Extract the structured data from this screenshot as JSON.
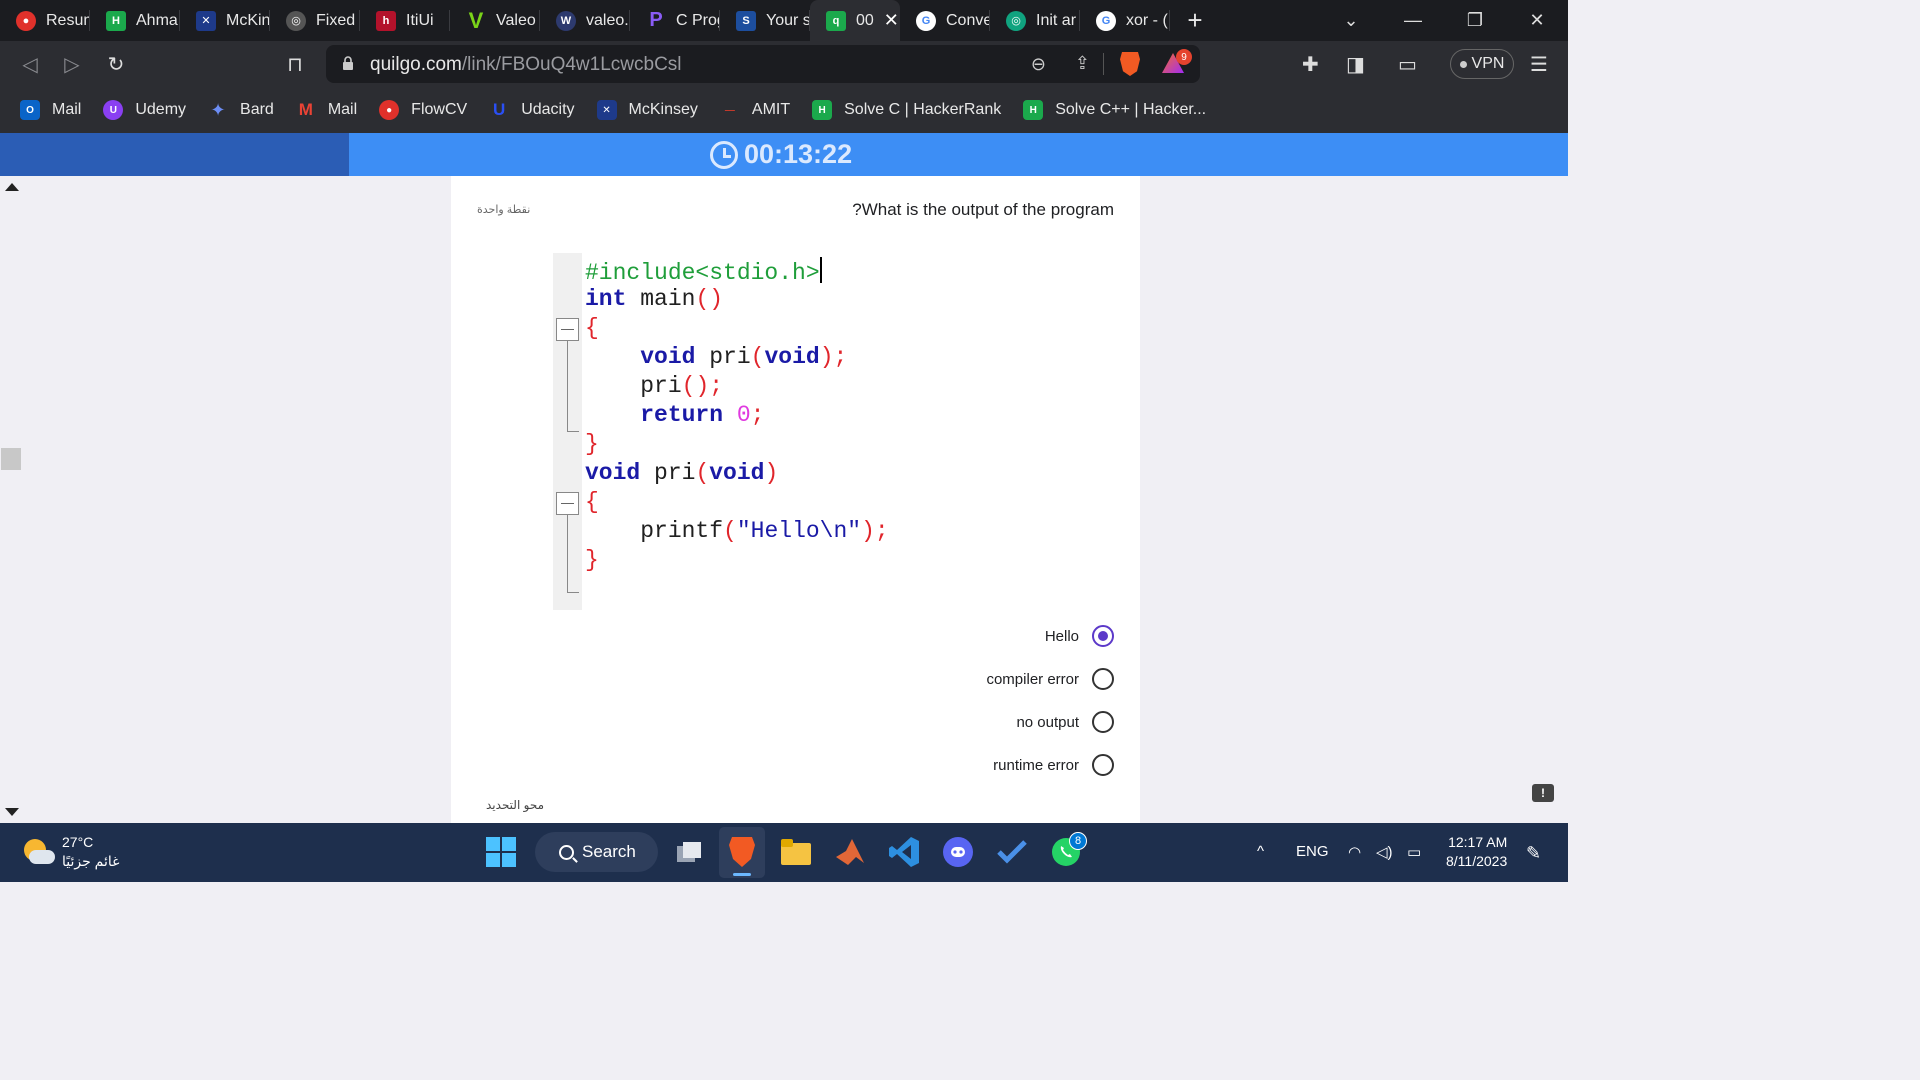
{
  "browser": {
    "tabs": [
      {
        "label": "Resum",
        "color": "#e0312b",
        "glyph": "●"
      },
      {
        "label": "Ahma",
        "color": "#1ba94c",
        "glyph": "H"
      },
      {
        "label": "McKin",
        "color": "#1e3a8a",
        "glyph": "✕"
      },
      {
        "label": "Fixed",
        "color": "#555555",
        "glyph": "◎"
      },
      {
        "label": "ItiUi",
        "color": "#b3122b",
        "glyph": "h"
      },
      {
        "label": "Valeo",
        "color": "#7ad319",
        "glyph": "V"
      },
      {
        "label": "valeo.",
        "color": "#2d3a6e",
        "glyph": "W"
      },
      {
        "label": "C Prog",
        "color": "#5b2ac7",
        "glyph": "P"
      },
      {
        "label": "Your s",
        "color": "#1d4e9e",
        "glyph": "S"
      },
      {
        "label": "00",
        "color": "#1ba94c",
        "glyph": "q",
        "active": true
      },
      {
        "label": "Conve",
        "color": "#ffffff",
        "glyph": "G"
      },
      {
        "label": "Init ar",
        "color": "#10a37f",
        "glyph": "◎"
      },
      {
        "label": "xor - (",
        "color": "#ffffff",
        "glyph": "G"
      }
    ],
    "new_tab_symbol": "+",
    "url_host": "quilgo.com",
    "url_path": "/link/FBOuQ4w1LcwcbCsl",
    "rewards_badge": "9",
    "vpn_label": "VPN",
    "bookmarks": [
      {
        "label": "Mail",
        "color": "#0a64c8",
        "glyph": "O"
      },
      {
        "label": "Udemy",
        "color": "#8a3ff2",
        "glyph": "U"
      },
      {
        "label": "Bard",
        "color": "#4b7bec",
        "glyph": "✦"
      },
      {
        "label": "Mail",
        "color": "#ea4335",
        "glyph": "M"
      },
      {
        "label": "FlowCV",
        "color": "#e0312b",
        "glyph": "●"
      },
      {
        "label": "Udacity",
        "color": "#2a4ff5",
        "glyph": "U"
      },
      {
        "label": "McKinsey",
        "color": "#1e3a8a",
        "glyph": "✕"
      },
      {
        "label": "AMIT",
        "color": "#c0392b",
        "glyph": "—"
      },
      {
        "label": "Solve C | HackerRank",
        "color": "#1ba94c",
        "glyph": "H"
      },
      {
        "label": "Solve C++ | Hacker...",
        "color": "#1ba94c",
        "glyph": "H"
      }
    ]
  },
  "quiz": {
    "timer": "00:13:22",
    "points_label": "نقطة واحدة",
    "question": "?What is the output of the program",
    "code": {
      "l1": "#include<stdio.h>",
      "l2_kw": "int",
      "l2_name": " main",
      "l2_paren": "()",
      "l3": "{",
      "l4_kw1": "void",
      "l4_name": " pri",
      "l4_p1": "(",
      "l4_kw2": "void",
      "l4_p2": ")",
      "l4_semi": ";",
      "l5_name": "pri",
      "l5_paren": "()",
      "l5_semi": ";",
      "l6_kw": "return",
      "l6_num": "0",
      "l6_semi": ";",
      "l7": "}",
      "l8_kw1": "void",
      "l8_name": " pri",
      "l8_p1": "(",
      "l8_kw2": "void",
      "l8_p2": ")",
      "l9": "{",
      "l10_name": "printf",
      "l10_p1": "(",
      "l10_str": "\"Hello\\n\"",
      "l10_p2": ")",
      "l10_semi": ";",
      "l11": "}"
    },
    "options": [
      {
        "label": "Hello",
        "selected": true
      },
      {
        "label": "compiler error",
        "selected": false
      },
      {
        "label": "no output",
        "selected": false
      },
      {
        "label": "runtime error",
        "selected": false
      }
    ],
    "clear_label": "محو التحديد",
    "accent_color": "#5c39c9"
  },
  "taskbar": {
    "temperature": "27°C",
    "weather_desc": "غائم جزئيًا",
    "search_label": "Search",
    "language": "ENG",
    "time": "12:17 AM",
    "date": "8/11/2023",
    "whatsapp_badge": "8"
  }
}
